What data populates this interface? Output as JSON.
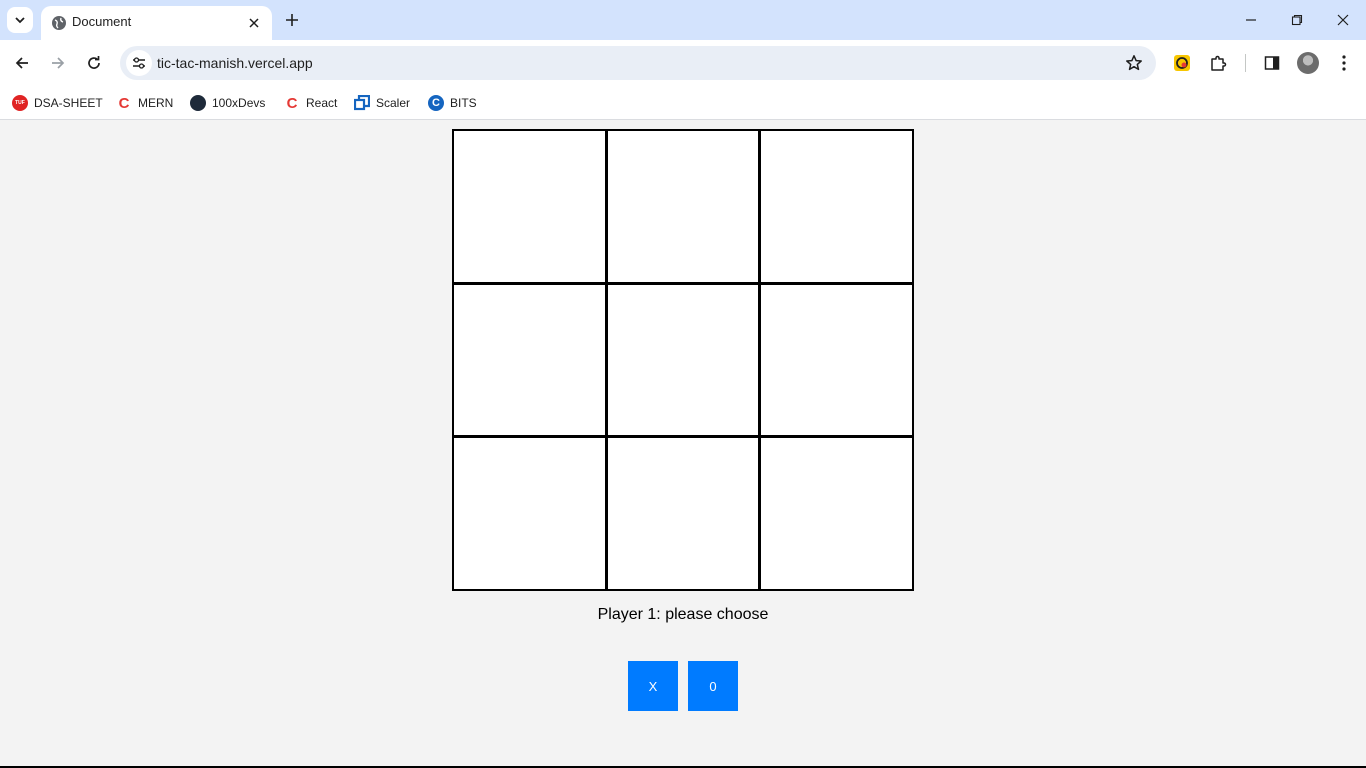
{
  "browser": {
    "tab_title": "Document",
    "url": "tic-tac-manish.vercel.app",
    "bookmarks": [
      {
        "label": "DSA-SHEET",
        "icon": "tuf-logo-icon"
      },
      {
        "label": "MERN",
        "icon": "c-logo-icon"
      },
      {
        "label": "100xDevs",
        "icon": "profile-photo-icon"
      },
      {
        "label": "React",
        "icon": "c-logo-icon"
      },
      {
        "label": "Scaler",
        "icon": "scaler-logo-icon"
      },
      {
        "label": "BITS",
        "icon": "bits-logo-icon"
      }
    ],
    "dsa_logo_text": "TUF"
  },
  "game": {
    "board": [
      "",
      "",
      "",
      "",
      "",
      "",
      "",
      "",
      ""
    ],
    "status": "Player 1: please choose",
    "choice_x": "X",
    "choice_o": "0",
    "accent": "#007bff"
  }
}
